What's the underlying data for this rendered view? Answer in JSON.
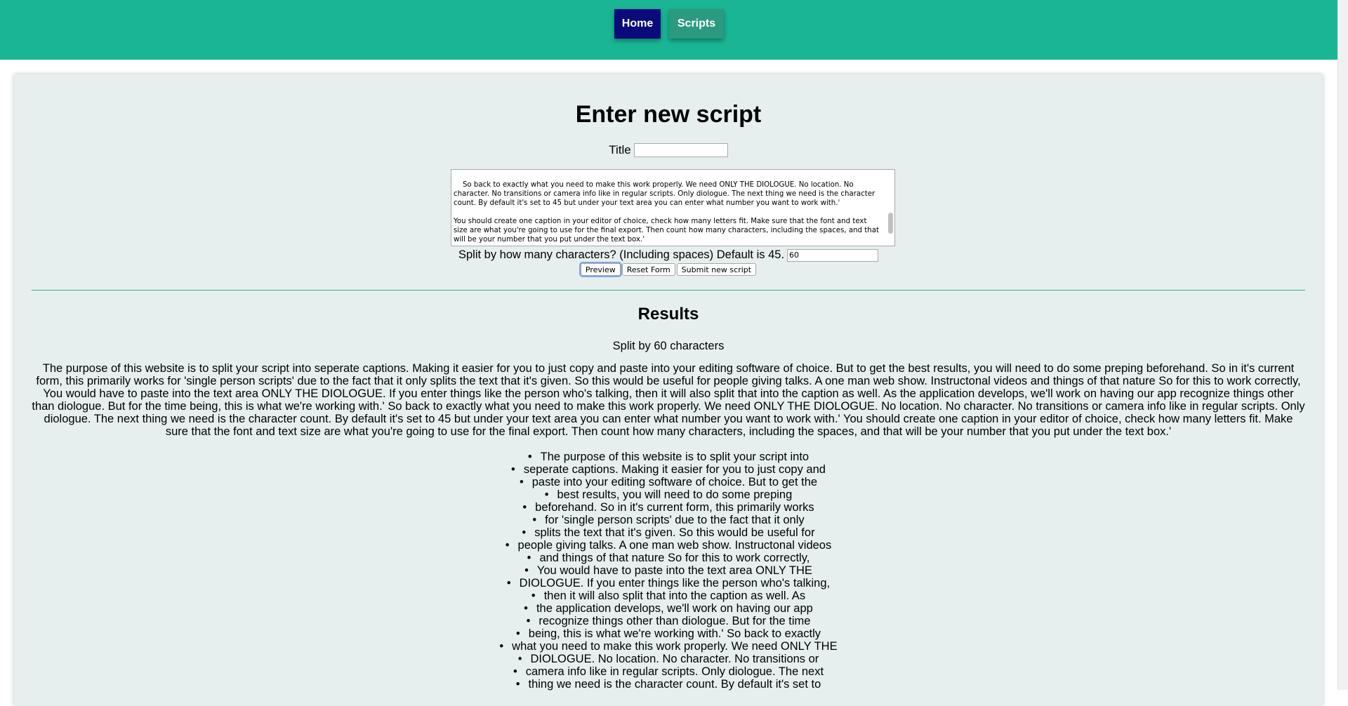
{
  "nav": {
    "home": "Home",
    "scripts": "Scripts"
  },
  "form": {
    "heading": "Enter new script",
    "title_label": "Title",
    "title_value": "",
    "script_text": "So back to exactly what you need to make this work properly. We need ONLY THE DIOLOGUE. No location. No character. No transitions or camera info like in regular scripts. Only diologue. The next thing we need is the character count. By default it's set to 45 but under your text area you can enter what number you want to work with.'\n\nYou should create one caption in your editor of choice, check how many letters fit. Make sure that the font and text size are what you're going to use for the final export. Then count how many characters, including the spaces, and that will be your number that you put under the text box.'",
    "split_label": "Split by how many characters? (Including spaces) Default is 45.",
    "split_value": "60",
    "preview_label": "Preview",
    "reset_label": "Reset Form",
    "submit_label": "Submit new script"
  },
  "results": {
    "heading": "Results",
    "split_by_text": "Split by 60 characters",
    "full_text": "The purpose of this website is to split your script into seperate captions. Making it easier for you to just copy and paste into your editing software of choice. But to get the best results, you will need to do some preping beforehand. So in it's current form, this primarily works for 'single person scripts' due to the fact that it only splits the text that it's given. So this would be useful for people giving talks. A one man web show. Instructonal videos and things of that nature So for this to work correctly, You would have to paste into the text area ONLY THE DIOLOGUE. If you enter things like the person who's talking, then it will also split that into the caption as well. As the application develops, we'll work on having our app recognize things other than diologue. But for the time being, this is what we're working with.' So back to exactly what you need to make this work properly. We need ONLY THE DIOLOGUE. No location. No character. No transitions or camera info like in regular scripts. Only diologue. The next thing we need is the character count. By default it's set to 45 but under your text area you can enter what number you want to work with.' You should create one caption in your editor of choice, check how many letters fit. Make sure that the font and text size are what you're going to use for the final export. Then count how many characters, including the spaces, and that will be your number that you put under the text box.'",
    "captions": [
      "The purpose of this website is to split your script into",
      "seperate captions. Making it easier for you to just copy and",
      "paste into your editing software of choice. But to get the",
      "best results, you will need to do some preping",
      "beforehand. So in it's current form, this primarily works",
      "for 'single person scripts' due to the fact that it only",
      "splits the text that it's given. So this would be useful for",
      "people giving talks. A one man web show. Instructonal videos",
      "and things of that nature So for this to work correctly,",
      "You would have to paste into the text area ONLY THE",
      "DIOLOGUE. If you enter things like the person who's talking,",
      "then it will also split that into the caption as well. As",
      "the application develops, we'll work on having our app",
      "recognize things other than diologue. But for the time",
      "being, this is what we're working with.' So back to exactly",
      "what you need to make this work properly. We need ONLY THE",
      "DIOLOGUE. No location. No character. No transitions or",
      "camera info like in regular scripts. Only diologue. The next",
      "thing we need is the character count. By default it's set to"
    ]
  }
}
